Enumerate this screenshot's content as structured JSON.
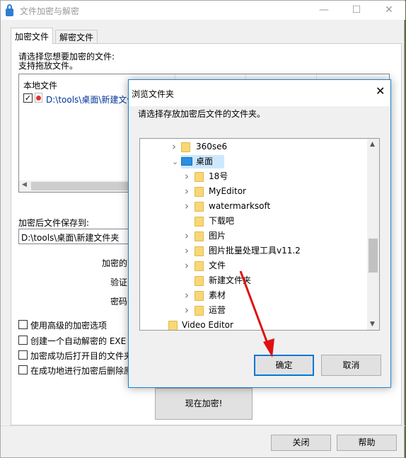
{
  "main": {
    "title": "文件加密与解密",
    "tabs": [
      {
        "label": "加密文件",
        "active": true
      },
      {
        "label": "解密文件"
      }
    ],
    "prompt1": "请选择您想要加密的文件:",
    "prompt2": "支持拖放文件。",
    "list_header": "本地文件",
    "files": [
      {
        "path": "D:\\tools\\桌面\\新建文件",
        "checked": true
      }
    ],
    "save_label": "加密后文件保存到:",
    "save_path": "D:\\tools\\桌面\\新建文件夹",
    "field_labels": [
      "加密的",
      "验证",
      "密码"
    ],
    "options": [
      {
        "label": "使用高级的加密选项",
        "checked": false
      },
      {
        "label": "创建一个自动解密的 EXE 文",
        "checked": false
      },
      {
        "label": "加密成功后打开目的文件夹",
        "checked": false
      },
      {
        "label": "在成功地进行加密后删除原",
        "checked": false
      }
    ],
    "encrypt_button": "现在加密!",
    "close_button": "关闭",
    "help_button": "帮助"
  },
  "dialog": {
    "title": "浏览文件夹",
    "prompt": "请选择存放加密后文件的文件夹。",
    "tree": [
      {
        "label": "360se6",
        "level": 1,
        "expander": "collapsed"
      },
      {
        "label": "桌面",
        "level": 1,
        "expander": "expanded",
        "selected": true,
        "icon": "desktop-icon"
      },
      {
        "label": "18号",
        "level": 2,
        "expander": "collapsed"
      },
      {
        "label": "MyEditor",
        "level": 2,
        "expander": "collapsed"
      },
      {
        "label": "watermarksoft",
        "level": 2,
        "expander": "collapsed"
      },
      {
        "label": "下载吧",
        "level": 2,
        "expander": "none"
      },
      {
        "label": "图片",
        "level": 2,
        "expander": "collapsed"
      },
      {
        "label": "图片批量处理工具v11.2",
        "level": 2,
        "expander": "collapsed"
      },
      {
        "label": "文件",
        "level": 2,
        "expander": "collapsed"
      },
      {
        "label": "新建文件夹",
        "level": 2,
        "expander": "none"
      },
      {
        "label": "素材",
        "level": 2,
        "expander": "collapsed"
      },
      {
        "label": "运营",
        "level": 2,
        "expander": "collapsed"
      },
      {
        "label": "Video Editor",
        "level": 0,
        "expander": "none"
      }
    ],
    "ok_button": "确定",
    "cancel_button": "取消"
  },
  "colors": {
    "accent": "#0078d7",
    "selection": "#cce8ff",
    "arrow": "#e01010"
  }
}
